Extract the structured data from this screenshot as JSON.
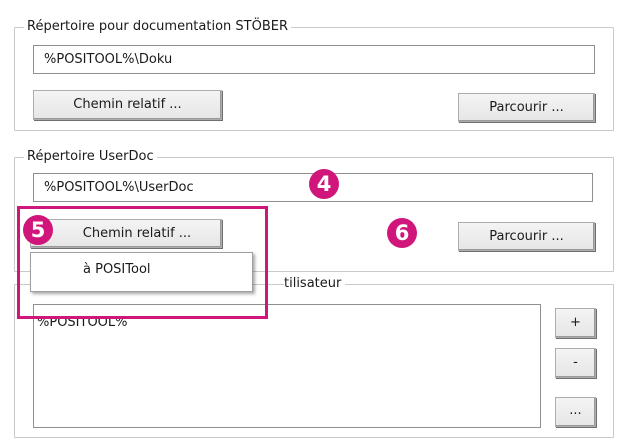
{
  "colors": {
    "accent": "#d0167a",
    "group_border": "#c9c9c9",
    "input_border": "#8f8f8f"
  },
  "group_doc": {
    "title": "Répertoire pour documentation STÖBER",
    "path_value": "%POSITOOL%\\Doku",
    "relative_button": "Chemin relatif ...",
    "browse_button": "Parcourir ..."
  },
  "group_userdoc": {
    "title": "Répertoire UserDoc",
    "path_value": "%POSITOOL%\\UserDoc",
    "relative_button": "Chemin relatif ...",
    "browse_button": "Parcourir ..."
  },
  "popup_menu": {
    "items": [
      {
        "label": "à POSITool"
      }
    ]
  },
  "group_user": {
    "title_visible": "tilisateur",
    "list_items": [
      "%POSITOOL%"
    ],
    "add_button": "+",
    "remove_button": "-",
    "more_button": "..."
  },
  "callouts": {
    "badge_4": "4",
    "badge_5": "5",
    "badge_6": "6"
  }
}
